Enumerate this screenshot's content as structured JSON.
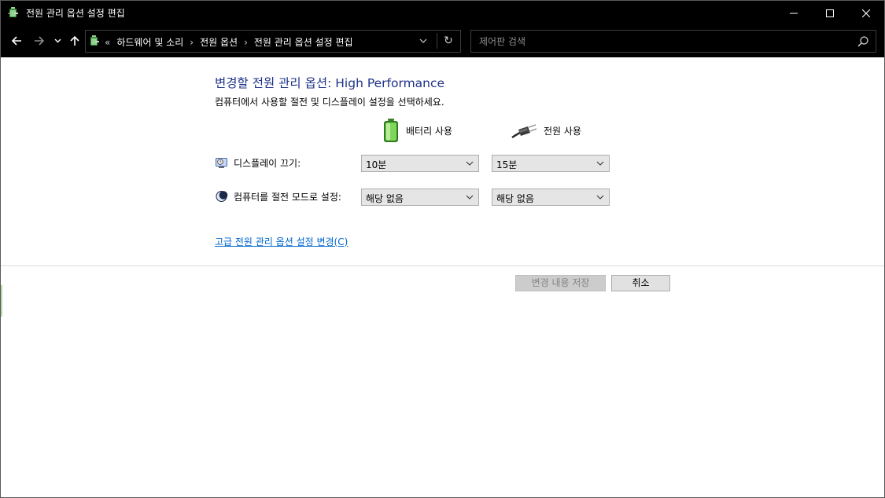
{
  "window": {
    "title": "전원 관리 옵션 설정 편집"
  },
  "address_bar": {
    "overflow": "«",
    "crumbs": [
      "하드웨어 및 소리",
      "전원 옵션",
      "전원 관리 옵션 설정 편집"
    ],
    "separator": "›",
    "refresh_glyph": "↻"
  },
  "search": {
    "placeholder": "제어판 검색",
    "value": ""
  },
  "main": {
    "heading": "변경할 전원 관리 옵션: High Performance",
    "subtext": "컴퓨터에서 사용할 절전 및 디스플레이 설정을 선택하세요.",
    "columns": {
      "battery": "배터리 사용",
      "plugged": "전원 사용"
    },
    "settings": [
      {
        "label": "디스플레이 끄기:",
        "battery": "10분",
        "plugged": "15분"
      },
      {
        "label": "컴퓨터를 절전 모드로 설정:",
        "battery": "해당 없음",
        "plugged": "해당 없음"
      }
    ],
    "advanced_link": "고급 전원 관리 옵션 설정 변경(C)"
  },
  "buttons": {
    "save": "변경 내용 저장",
    "cancel": "취소"
  },
  "icons": {
    "app": "power-options-icon",
    "battery": "battery-icon",
    "plug": "power-plug-icon",
    "display": "display-timer-icon",
    "sleep": "moon-sleep-icon"
  },
  "colors": {
    "heading": "#1e3287",
    "link": "#0066cc",
    "titlebar": "#000000"
  }
}
